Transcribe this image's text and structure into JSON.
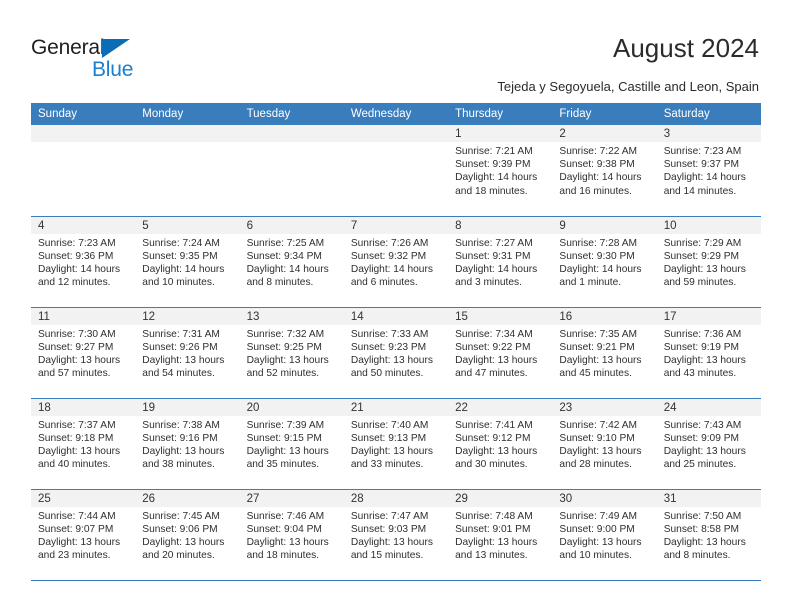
{
  "brand": {
    "name_top": "General",
    "name_bottom": "Blue",
    "accent_color": "#1b7fd0",
    "triangle_color": "#0c6cb5"
  },
  "header": {
    "title": "August 2024",
    "subtitle": "Tejeda y Segoyuela, Castille and Leon, Spain"
  },
  "calendar": {
    "header_bg": "#3a7dbd",
    "daynum_bg": "#f2f2f2",
    "weekday_headers": [
      "Sunday",
      "Monday",
      "Tuesday",
      "Wednesday",
      "Thursday",
      "Friday",
      "Saturday"
    ],
    "weeks": [
      [
        {
          "day": "",
          "sunrise": "",
          "sunset": "",
          "daylight_1": "",
          "daylight_2": ""
        },
        {
          "day": "",
          "sunrise": "",
          "sunset": "",
          "daylight_1": "",
          "daylight_2": ""
        },
        {
          "day": "",
          "sunrise": "",
          "sunset": "",
          "daylight_1": "",
          "daylight_2": ""
        },
        {
          "day": "",
          "sunrise": "",
          "sunset": "",
          "daylight_1": "",
          "daylight_2": ""
        },
        {
          "day": "1",
          "sunrise": "Sunrise: 7:21 AM",
          "sunset": "Sunset: 9:39 PM",
          "daylight_1": "Daylight: 14 hours",
          "daylight_2": "and 18 minutes."
        },
        {
          "day": "2",
          "sunrise": "Sunrise: 7:22 AM",
          "sunset": "Sunset: 9:38 PM",
          "daylight_1": "Daylight: 14 hours",
          "daylight_2": "and 16 minutes."
        },
        {
          "day": "3",
          "sunrise": "Sunrise: 7:23 AM",
          "sunset": "Sunset: 9:37 PM",
          "daylight_1": "Daylight: 14 hours",
          "daylight_2": "and 14 minutes."
        }
      ],
      [
        {
          "day": "4",
          "sunrise": "Sunrise: 7:23 AM",
          "sunset": "Sunset: 9:36 PM",
          "daylight_1": "Daylight: 14 hours",
          "daylight_2": "and 12 minutes."
        },
        {
          "day": "5",
          "sunrise": "Sunrise: 7:24 AM",
          "sunset": "Sunset: 9:35 PM",
          "daylight_1": "Daylight: 14 hours",
          "daylight_2": "and 10 minutes."
        },
        {
          "day": "6",
          "sunrise": "Sunrise: 7:25 AM",
          "sunset": "Sunset: 9:34 PM",
          "daylight_1": "Daylight: 14 hours",
          "daylight_2": "and 8 minutes."
        },
        {
          "day": "7",
          "sunrise": "Sunrise: 7:26 AM",
          "sunset": "Sunset: 9:32 PM",
          "daylight_1": "Daylight: 14 hours",
          "daylight_2": "and 6 minutes."
        },
        {
          "day": "8",
          "sunrise": "Sunrise: 7:27 AM",
          "sunset": "Sunset: 9:31 PM",
          "daylight_1": "Daylight: 14 hours",
          "daylight_2": "and 3 minutes."
        },
        {
          "day": "9",
          "sunrise": "Sunrise: 7:28 AM",
          "sunset": "Sunset: 9:30 PM",
          "daylight_1": "Daylight: 14 hours",
          "daylight_2": "and 1 minute."
        },
        {
          "day": "10",
          "sunrise": "Sunrise: 7:29 AM",
          "sunset": "Sunset: 9:29 PM",
          "daylight_1": "Daylight: 13 hours",
          "daylight_2": "and 59 minutes."
        }
      ],
      [
        {
          "day": "11",
          "sunrise": "Sunrise: 7:30 AM",
          "sunset": "Sunset: 9:27 PM",
          "daylight_1": "Daylight: 13 hours",
          "daylight_2": "and 57 minutes."
        },
        {
          "day": "12",
          "sunrise": "Sunrise: 7:31 AM",
          "sunset": "Sunset: 9:26 PM",
          "daylight_1": "Daylight: 13 hours",
          "daylight_2": "and 54 minutes."
        },
        {
          "day": "13",
          "sunrise": "Sunrise: 7:32 AM",
          "sunset": "Sunset: 9:25 PM",
          "daylight_1": "Daylight: 13 hours",
          "daylight_2": "and 52 minutes."
        },
        {
          "day": "14",
          "sunrise": "Sunrise: 7:33 AM",
          "sunset": "Sunset: 9:23 PM",
          "daylight_1": "Daylight: 13 hours",
          "daylight_2": "and 50 minutes."
        },
        {
          "day": "15",
          "sunrise": "Sunrise: 7:34 AM",
          "sunset": "Sunset: 9:22 PM",
          "daylight_1": "Daylight: 13 hours",
          "daylight_2": "and 47 minutes."
        },
        {
          "day": "16",
          "sunrise": "Sunrise: 7:35 AM",
          "sunset": "Sunset: 9:21 PM",
          "daylight_1": "Daylight: 13 hours",
          "daylight_2": "and 45 minutes."
        },
        {
          "day": "17",
          "sunrise": "Sunrise: 7:36 AM",
          "sunset": "Sunset: 9:19 PM",
          "daylight_1": "Daylight: 13 hours",
          "daylight_2": "and 43 minutes."
        }
      ],
      [
        {
          "day": "18",
          "sunrise": "Sunrise: 7:37 AM",
          "sunset": "Sunset: 9:18 PM",
          "daylight_1": "Daylight: 13 hours",
          "daylight_2": "and 40 minutes."
        },
        {
          "day": "19",
          "sunrise": "Sunrise: 7:38 AM",
          "sunset": "Sunset: 9:16 PM",
          "daylight_1": "Daylight: 13 hours",
          "daylight_2": "and 38 minutes."
        },
        {
          "day": "20",
          "sunrise": "Sunrise: 7:39 AM",
          "sunset": "Sunset: 9:15 PM",
          "daylight_1": "Daylight: 13 hours",
          "daylight_2": "and 35 minutes."
        },
        {
          "day": "21",
          "sunrise": "Sunrise: 7:40 AM",
          "sunset": "Sunset: 9:13 PM",
          "daylight_1": "Daylight: 13 hours",
          "daylight_2": "and 33 minutes."
        },
        {
          "day": "22",
          "sunrise": "Sunrise: 7:41 AM",
          "sunset": "Sunset: 9:12 PM",
          "daylight_1": "Daylight: 13 hours",
          "daylight_2": "and 30 minutes."
        },
        {
          "day": "23",
          "sunrise": "Sunrise: 7:42 AM",
          "sunset": "Sunset: 9:10 PM",
          "daylight_1": "Daylight: 13 hours",
          "daylight_2": "and 28 minutes."
        },
        {
          "day": "24",
          "sunrise": "Sunrise: 7:43 AM",
          "sunset": "Sunset: 9:09 PM",
          "daylight_1": "Daylight: 13 hours",
          "daylight_2": "and 25 minutes."
        }
      ],
      [
        {
          "day": "25",
          "sunrise": "Sunrise: 7:44 AM",
          "sunset": "Sunset: 9:07 PM",
          "daylight_1": "Daylight: 13 hours",
          "daylight_2": "and 23 minutes."
        },
        {
          "day": "26",
          "sunrise": "Sunrise: 7:45 AM",
          "sunset": "Sunset: 9:06 PM",
          "daylight_1": "Daylight: 13 hours",
          "daylight_2": "and 20 minutes."
        },
        {
          "day": "27",
          "sunrise": "Sunrise: 7:46 AM",
          "sunset": "Sunset: 9:04 PM",
          "daylight_1": "Daylight: 13 hours",
          "daylight_2": "and 18 minutes."
        },
        {
          "day": "28",
          "sunrise": "Sunrise: 7:47 AM",
          "sunset": "Sunset: 9:03 PM",
          "daylight_1": "Daylight: 13 hours",
          "daylight_2": "and 15 minutes."
        },
        {
          "day": "29",
          "sunrise": "Sunrise: 7:48 AM",
          "sunset": "Sunset: 9:01 PM",
          "daylight_1": "Daylight: 13 hours",
          "daylight_2": "and 13 minutes."
        },
        {
          "day": "30",
          "sunrise": "Sunrise: 7:49 AM",
          "sunset": "Sunset: 9:00 PM",
          "daylight_1": "Daylight: 13 hours",
          "daylight_2": "and 10 minutes."
        },
        {
          "day": "31",
          "sunrise": "Sunrise: 7:50 AM",
          "sunset": "Sunset: 8:58 PM",
          "daylight_1": "Daylight: 13 hours",
          "daylight_2": "and 8 minutes."
        }
      ]
    ]
  }
}
